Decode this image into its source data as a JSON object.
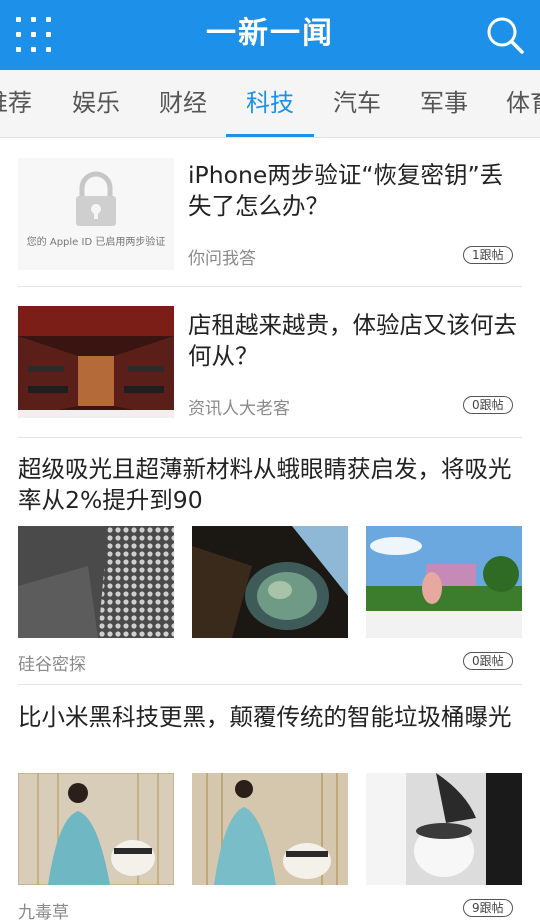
{
  "header": {
    "title": "一新一闻",
    "menu_icon": "grid-menu-icon",
    "search_icon": "search-icon",
    "brand_color": "#1d91ea"
  },
  "tabs": [
    {
      "label": "推荐",
      "partial_text": "推荐"
    },
    {
      "label": "娱乐"
    },
    {
      "label": "财经"
    },
    {
      "label": "科技",
      "active": true
    },
    {
      "label": "汽车"
    },
    {
      "label": "军事"
    },
    {
      "label": "体育",
      "partial_text": "体育"
    }
  ],
  "feed": [
    {
      "title": "iPhone两步验证“恢复密钥”丢失了怎么办？",
      "source": "你问我答",
      "comments": "1跟帖",
      "thumb_caption": "您的 Apple ID 已启用两步验证"
    },
    {
      "title": "店租越来越贵，体验店又该何去何从？",
      "source": "资讯人大老客",
      "comments": "0跟帖"
    },
    {
      "title": "超级吸光且超薄新材料从蛾眼睛获启发，将吸光率从2%提升到90",
      "source": "硅谷密探",
      "comments": "0跟帖"
    },
    {
      "title": "比小米黑科技更黑，颠覆传统的智能垃圾桶曝光",
      "source": "九毒草",
      "comments": "9跟帖"
    }
  ]
}
